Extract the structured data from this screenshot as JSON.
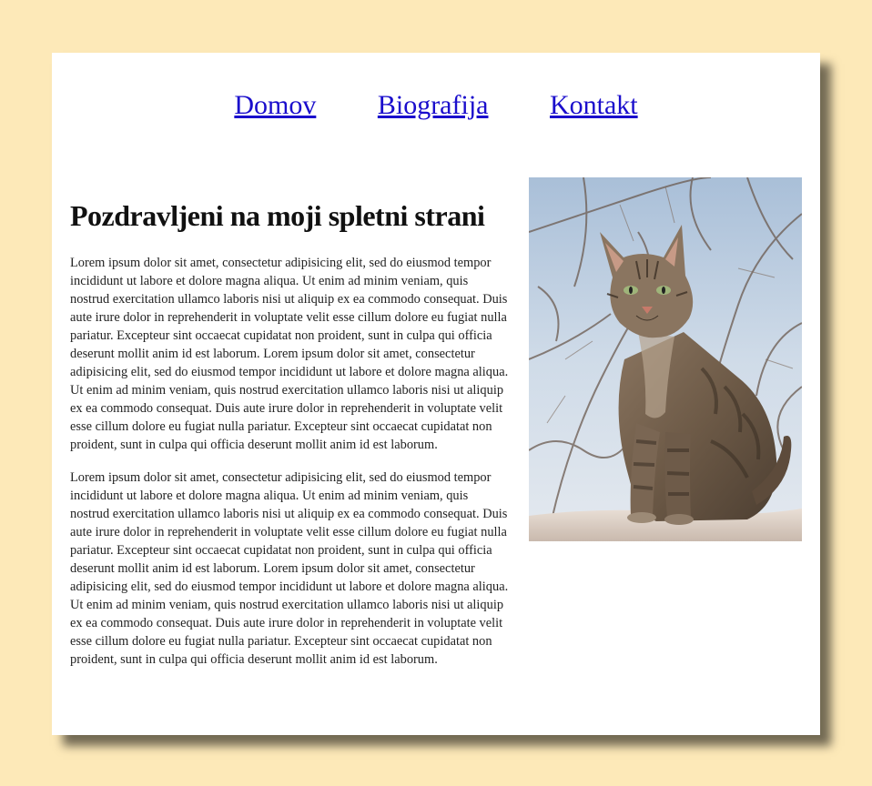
{
  "nav": {
    "items": [
      {
        "label": "Domov"
      },
      {
        "label": "Biografija"
      },
      {
        "label": "Kontakt"
      }
    ]
  },
  "main": {
    "heading": "Pozdravljeni na moji spletni strani",
    "paragraphs": [
      "Lorem ipsum dolor sit amet, consectetur adipisicing elit, sed do eiusmod tempor incididunt ut labore et dolore magna aliqua. Ut enim ad minim veniam, quis nostrud exercitation ullamco laboris nisi ut aliquip ex ea commodo consequat. Duis aute irure dolor in reprehenderit in voluptate velit esse cillum dolore eu fugiat nulla pariatur. Excepteur sint occaecat cupidatat non proident, sunt in culpa qui officia deserunt mollit anim id est laborum. Lorem ipsum dolor sit amet, consectetur adipisicing elit, sed do eiusmod tempor incididunt ut labore et dolore magna aliqua. Ut enim ad minim veniam, quis nostrud exercitation ullamco laboris nisi ut aliquip ex ea commodo consequat. Duis aute irure dolor in reprehenderit in voluptate velit esse cillum dolore eu fugiat nulla pariatur. Excepteur sint occaecat cupidatat non proident, sunt in culpa qui officia deserunt mollit anim id est laborum.",
      "Lorem ipsum dolor sit amet, consectetur adipisicing elit, sed do eiusmod tempor incididunt ut labore et dolore magna aliqua. Ut enim ad minim veniam, quis nostrud exercitation ullamco laboris nisi ut aliquip ex ea commodo consequat. Duis aute irure dolor in reprehenderit in voluptate velit esse cillum dolore eu fugiat nulla pariatur. Excepteur sint occaecat cupidatat non proident, sunt in culpa qui officia deserunt mollit anim id est laborum. Lorem ipsum dolor sit amet, consectetur adipisicing elit, sed do eiusmod tempor incididunt ut labore et dolore magna aliqua. Ut enim ad minim veniam, quis nostrud exercitation ullamco laboris nisi ut aliquip ex ea commodo consequat. Duis aute irure dolor in reprehenderit in voluptate velit esse cillum dolore eu fugiat nulla pariatur. Excepteur sint occaecat cupidatat non proident, sunt in culpa qui officia deserunt mollit anim id est laborum."
    ]
  },
  "colors": {
    "page_background": "#fde9b8",
    "card_background": "#ffffff",
    "link": "#1a0dcc"
  },
  "image": {
    "subject": "tabby-cat-photo"
  }
}
